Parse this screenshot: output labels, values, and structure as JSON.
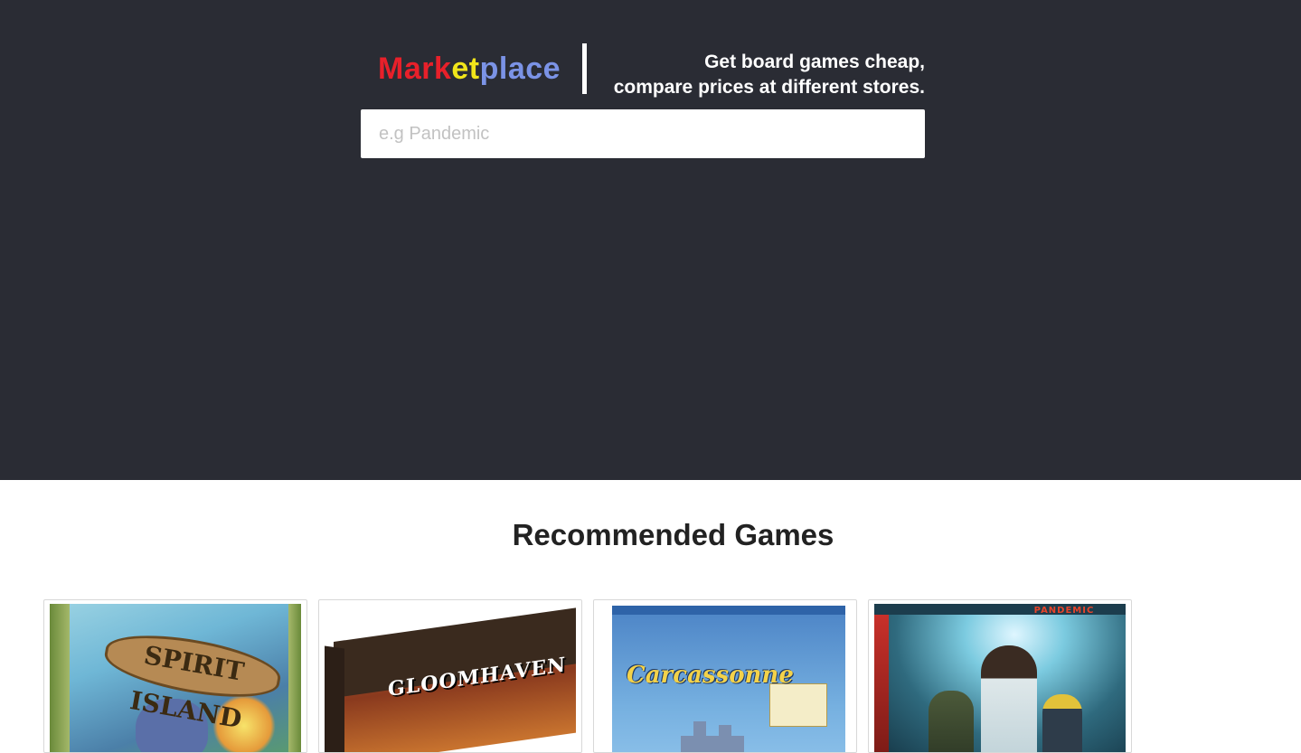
{
  "header": {
    "brand": {
      "part1": "Mark",
      "part2": "et",
      "part3": "place"
    },
    "tagline_line1": "Get board games cheap,",
    "tagline_line2": "compare prices at different stores.",
    "search_placeholder": "e.g Pandemic",
    "brand_colors": {
      "red": "#e8202a",
      "yellow": "#f1e51a",
      "blue": "#7b93e6"
    },
    "background": "#2a2c34"
  },
  "recommended": {
    "title": "Recommended Games",
    "games": [
      {
        "box_text": "SPIRIT ISLAND",
        "icon": "spirit-island-box-art"
      },
      {
        "box_text": "GLOOMHAVEN",
        "icon": "gloomhaven-box-art"
      },
      {
        "box_text": "Carcassonne",
        "icon": "carcassonne-box-art"
      },
      {
        "box_text": "PANDEMIC",
        "icon": "pandemic-box-art"
      }
    ]
  }
}
